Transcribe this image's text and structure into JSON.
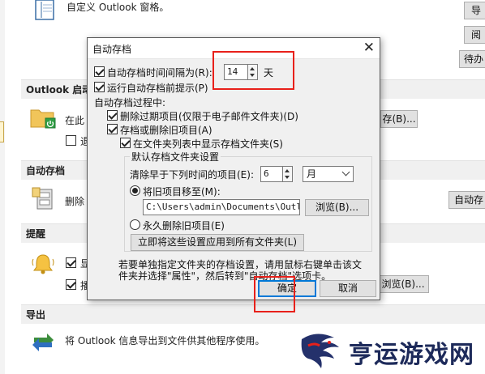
{
  "background": {
    "top_text": "自定义 Outlook 窗格。",
    "right_buttons": [
      "导",
      "阅",
      "待办"
    ],
    "sections": {
      "startup": {
        "header": "Outlook 启动",
        "text_partial": "在此",
        "check_partial": "退",
        "button_partial": "存(B)..."
      },
      "autoarchive": {
        "header": "自动存档",
        "text_partial": "删除",
        "button_partial": "自动存"
      },
      "reminders": {
        "header": "提醒",
        "check1_partial": "显",
        "check2_partial": "播",
        "button_partial": "浏览(B)..."
      },
      "export": {
        "header": "导出",
        "text": "将 Outlook 信息导出到文件供其他程序使用。"
      }
    }
  },
  "dialog": {
    "title": "自动存档",
    "close_glyph": "✕",
    "run_every_label": "自动存档时间间隔为(R):",
    "run_every_value": "14",
    "run_every_unit": "天",
    "prompt_label": "运行自动存档前提示(P)",
    "during_label": "自动存档过程中:",
    "delete_expired_label": "删除过期项目(仅限于电子邮件文件夹)(D)",
    "archive_or_delete_label": "存档或删除旧项目(A)",
    "show_folder_label": "在文件夹列表中显示存档文件夹(S)",
    "defaults_label": "默认存档文件夹设置",
    "clean_older_label": "清除早于下列时间的项目(E):",
    "clean_older_value": "6",
    "clean_older_unit": "月",
    "move_label": "将旧项目移至(M):",
    "path_value": "C:\\Users\\admin\\Documents\\Outloo",
    "browse_label": "浏览(B)...",
    "permanent_delete_label": "永久删除旧项目(E)",
    "apply_all_label": "立即将这些设置应用到所有文件夹(L)",
    "hint_text_line1": "若要单独指定文件夹的存档设置，请用鼠标右键单击该文",
    "hint_text_line2": "件夹并选择\"属性\"，然后转到\"自动存档\"选项卡。",
    "ok_label": "确定",
    "cancel_label": "取消"
  },
  "watermark": {
    "text": "亨运游戏网"
  },
  "colors": {
    "highlight_red": "#e8201a",
    "dialog_bg": "#f0f0f0",
    "section_bg": "#f0f0f0",
    "watermark_text": "#1d2a5a"
  }
}
